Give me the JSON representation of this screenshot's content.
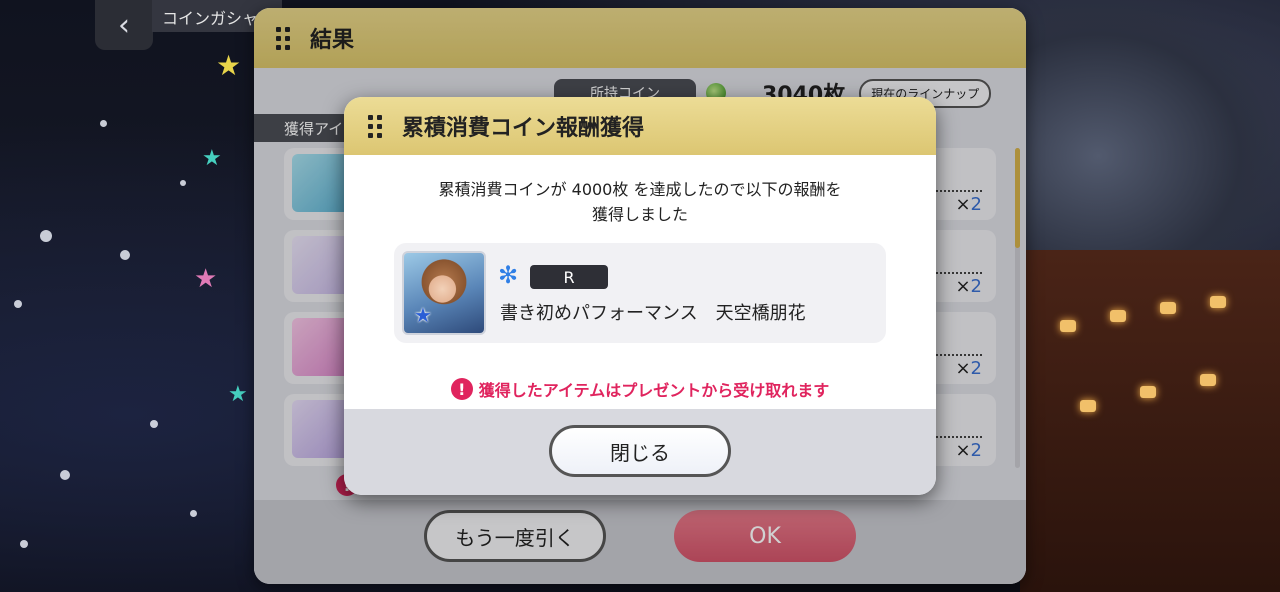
{
  "background": {
    "screen_title": "コインガシャ",
    "back_icon": "chevron-left-icon"
  },
  "result_panel": {
    "title": "結果",
    "coin_label": "所持コイン",
    "coin_value": "3040枚",
    "lineup_button": "現在のラインナップ",
    "acquired_label": "獲得アイテム",
    "items": [
      {
        "count_prefix": "×",
        "count": "2"
      },
      {
        "count_prefix": "×",
        "count": "2"
      },
      {
        "count_prefix": "×",
        "count": "2"
      },
      {
        "count_prefix": "×",
        "count": "2"
      }
    ],
    "again_button": "もう一度引く",
    "ok_button": "OK"
  },
  "modal": {
    "title": "累積消費コイン報酬獲得",
    "message_line1": "累積消費コインが 4000枚 を達成したので以下の報酬を",
    "message_line2": "獲得しました",
    "reward": {
      "rarity": "R",
      "name": "書き初めパフォーマンス　天空橋朋花",
      "type_icon": "snowflake-icon"
    },
    "notice_icon": "!",
    "notice": "獲得したアイテムはプレゼントから受け取れます",
    "close_button": "閉じる"
  },
  "colors": {
    "header_gold": "#dcc672",
    "notice_pink": "#e0245e",
    "ok_red": "#d2546a",
    "type_blue": "#2f7fe6"
  }
}
